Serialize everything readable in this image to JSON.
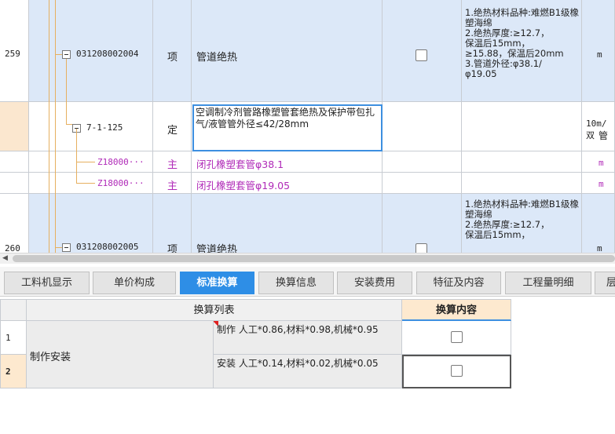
{
  "upper_grid": {
    "rows": [
      {
        "num": "259",
        "code": "031208002004",
        "type": "项",
        "name": "管道绝热",
        "features": "1.绝热材料品种:难燃B1级橡塑海绵\n2.绝热厚度:≥12.7，\n保温后15mm，\n≥15.88，保温后20mm\n3.管道外径:φ38.1/\nφ19.05",
        "unit": "m"
      },
      {
        "code": "7-1-125",
        "type": "定",
        "name": "空调制冷剂管路橡塑管套绝热及保护带包扎 气/液管管外径≤42/28mm",
        "unit_line1": "10m/双",
        "unit_line2": "管"
      },
      {
        "code": "Z18000···",
        "type": "主",
        "name": "闭孔橡塑套管φ38.1",
        "unit": "m"
      },
      {
        "code": "Z18000···",
        "type": "主",
        "name": "闭孔橡塑套管φ19.05",
        "unit": "m"
      },
      {
        "num": "260",
        "code": "031208002005",
        "type": "项",
        "name": "管道绝热",
        "features": "1.绝热材料品种:难燃B1级橡塑海绵\n2.绝热厚度:≥12.7，\n保温后15mm，",
        "unit": "m"
      }
    ]
  },
  "tabs": [
    {
      "label": "工料机显示",
      "active": false
    },
    {
      "label": "单价构成",
      "active": false
    },
    {
      "label": "标准换算",
      "active": true
    },
    {
      "label": "换算信息",
      "active": false
    },
    {
      "label": "安装费用",
      "active": false
    },
    {
      "label": "特征及内容",
      "active": false
    },
    {
      "label": "工程量明细",
      "active": false
    },
    {
      "label": "层",
      "active": false
    }
  ],
  "conversion_table": {
    "header_list": "换算列表",
    "header_content": "换算内容",
    "group_label": "制作安装",
    "rows": [
      {
        "num": "1",
        "text": "制作 人工*0.86,材料*0.98,机械*0.95"
      },
      {
        "num": "2",
        "text": "安装 人工*0.14,材料*0.02,机械*0.05"
      }
    ]
  },
  "colors": {
    "selected_row": "#dce8f8",
    "material_text": "#b02ab8",
    "active_tab": "#2e8ee6",
    "header_highlight": "#fde9cf"
  }
}
